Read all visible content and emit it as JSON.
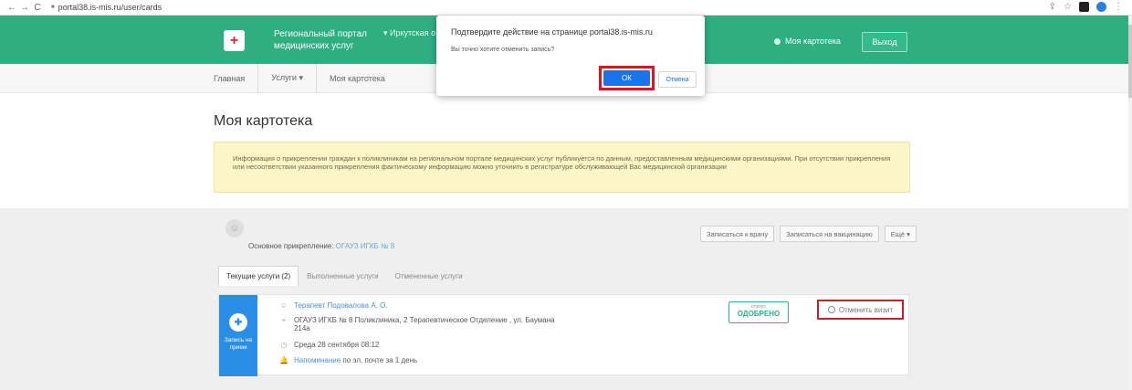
{
  "browser": {
    "back_icon": "arrow-left-icon",
    "forward_icon": "arrow-right-icon",
    "reload_icon": "reload-icon",
    "url": "portal38.is-mis.ru/user/cards",
    "back": "←",
    "forward": "→",
    "reload": "C",
    "lock": "■",
    "share": "⇪",
    "star": "☆"
  },
  "header": {
    "logo_symbol": "+",
    "portal_name": "Региональный портал медицинских услуг",
    "region": "▾ Иркутская о",
    "my_cards_label": "Моя картотека",
    "logout_label": "Выход"
  },
  "breadcrumbs": [
    "Главная",
    "Услуги ▾",
    "Моя картотека"
  ],
  "page": {
    "title": "Моя картотека",
    "info_text": "Информация о прикреплении граждан к поликлиникам на региональном портале медицинских услуг публикуется по данным, предоставленным медицинскими организациями. При отсутствии прикрепления или несоответствии указанного прикрепления фактическому информацию можно уточнить в регистратуре обслуживающей Вас медицинской организации"
  },
  "profile": {
    "avatar_glyph": "☺",
    "attachment_label": "Основное прикрепление:",
    "attachment_value": "ОГАУЗ ИГКБ № 8",
    "buttons": [
      "Записаться к врачу",
      "Записаться на вакцинацию",
      "Ещё ▾"
    ]
  },
  "tabs": [
    "Текущие услуги (2)",
    "Выполненные услуги",
    "Отмененные услуги"
  ],
  "card": {
    "type_label": "Запись на прием",
    "type_glyph": "✚",
    "doctor": "Терапевт Подовалова А. О.",
    "clinic": "ОГАУЗ ИГКБ № 8 Поликлиника, 2 Терапевтическое Отделение , ул. Баумана 214а",
    "datetime": "Среда 28 сентября 08:12",
    "reminder_link": "Напоминание",
    "reminder_rest": "по эл. почте за 1 день",
    "status_caption": "статус",
    "status_value": "ОДОБРЕНО",
    "cancel_label": "Отменить визит",
    "icons": {
      "doctor": "☺",
      "clinic": "⌖",
      "time": "◷",
      "reminder": "🔔"
    }
  },
  "dialog": {
    "title": "Подтвердите действие на странице portal38.is-mis.ru",
    "message": "Вы точно хотите отменить запись?",
    "ok_label": "ОК",
    "cancel_label": "Отмена"
  },
  "colors": {
    "header_green": "#2fae82",
    "highlight_red": "#d11a2a",
    "primary_blue": "#1a73e8",
    "card_blue": "#2b8ee6",
    "info_yellow": "#fbf5c7"
  }
}
